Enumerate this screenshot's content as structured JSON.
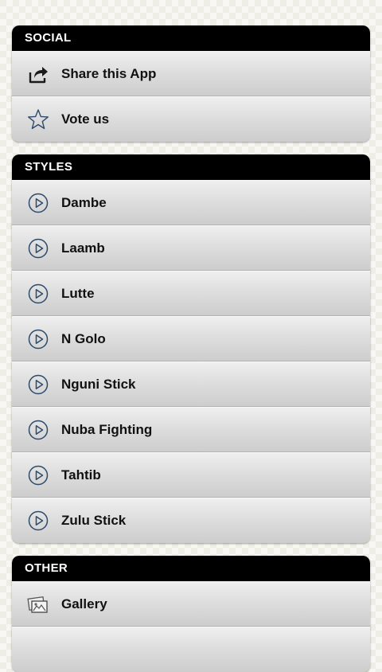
{
  "sections": [
    {
      "header": "SOCIAL",
      "items": [
        {
          "label": "Share this App",
          "icon": "share-icon"
        },
        {
          "label": "Vote us",
          "icon": "star-icon"
        }
      ]
    },
    {
      "header": "STYLES",
      "items": [
        {
          "label": "Dambe",
          "icon": "play-icon"
        },
        {
          "label": "Laamb",
          "icon": "play-icon"
        },
        {
          "label": "Lutte",
          "icon": "play-icon"
        },
        {
          "label": "N Golo",
          "icon": "play-icon"
        },
        {
          "label": "Nguni Stick",
          "icon": "play-icon"
        },
        {
          "label": "Nuba Fighting",
          "icon": "play-icon"
        },
        {
          "label": "Tahtib",
          "icon": "play-icon"
        },
        {
          "label": "Zulu Stick",
          "icon": "play-icon"
        }
      ]
    },
    {
      "header": "OTHER",
      "items": [
        {
          "label": "Gallery",
          "icon": "gallery-icon"
        },
        {
          "label": "",
          "icon": ""
        }
      ]
    }
  ],
  "colors": {
    "header_background": "#000000",
    "header_text": "#ffffff",
    "icon_stroke": "#2c4a6b"
  }
}
